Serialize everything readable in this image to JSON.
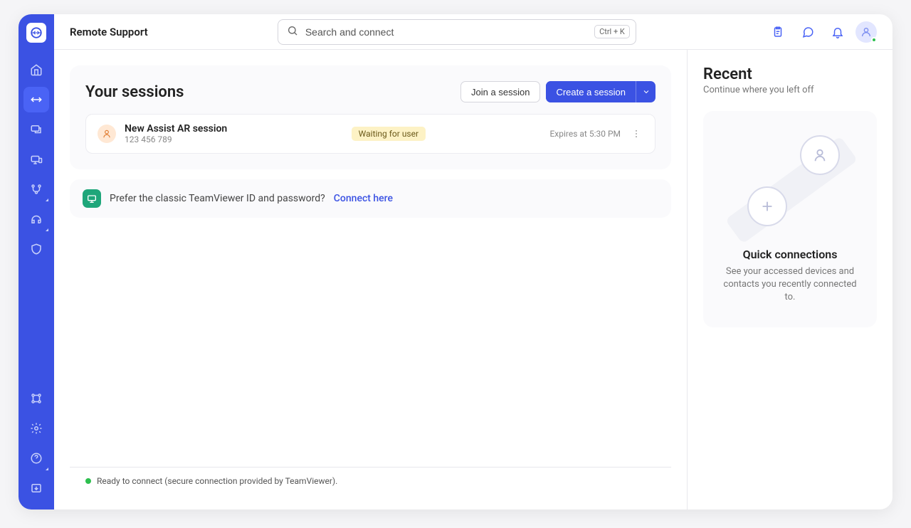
{
  "page_title": "Remote Support",
  "search": {
    "placeholder": "Search and connect",
    "shortcut": "Ctrl + K"
  },
  "sessions": {
    "heading": "Your sessions",
    "join_label": "Join a session",
    "create_label": "Create a session",
    "items": [
      {
        "name": "New Assist AR session",
        "code": "123 456 789",
        "status": "Waiting for user",
        "expires": "Expires at 5:30 PM"
      }
    ]
  },
  "classic": {
    "text": "Prefer the classic TeamViewer ID and password?",
    "link": "Connect here"
  },
  "recent": {
    "title": "Recent",
    "subtitle": "Continue where you left off",
    "quick_title": "Quick connections",
    "quick_desc": "See your accessed devices and contacts you recently connected to."
  },
  "status": "Ready to connect (secure connection provided by TeamViewer)."
}
